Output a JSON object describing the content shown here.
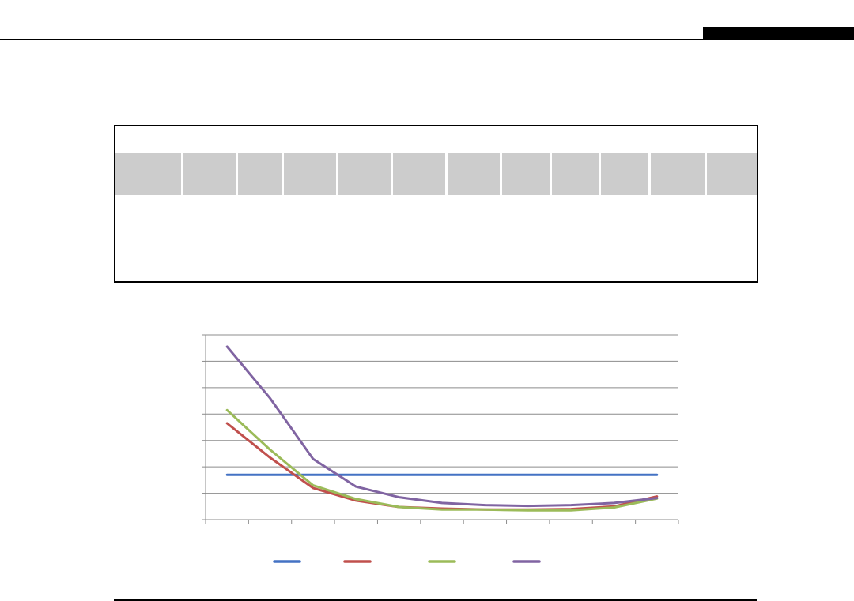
{
  "page": {
    "header_text": "",
    "table_title": ""
  },
  "table": {
    "header_cells": [
      "",
      "",
      "",
      "",
      "",
      "",
      "",
      "",
      "",
      "",
      "",
      ""
    ],
    "rows": []
  },
  "chart_data": {
    "type": "line",
    "title": "",
    "xlabel": "",
    "ylabel": "",
    "x": [
      1,
      2,
      3,
      4,
      5,
      6,
      7,
      8,
      9,
      10,
      11
    ],
    "ylim": [
      0,
      7
    ],
    "yticks": [
      0,
      1,
      2,
      3,
      4,
      5,
      6,
      7
    ],
    "grid": true,
    "legend_position": "bottom",
    "series": [
      {
        "color": "#4472C4",
        "values": [
          1.7,
          1.7,
          1.7,
          1.7,
          1.7,
          1.7,
          1.7,
          1.7,
          1.7,
          1.7,
          1.7
        ]
      },
      {
        "color": "#C0504D",
        "values": [
          3.65,
          2.35,
          1.2,
          0.72,
          0.48,
          0.42,
          0.38,
          0.38,
          0.4,
          0.5,
          0.88
        ]
      },
      {
        "color": "#9BBB59",
        "values": [
          4.15,
          2.65,
          1.3,
          0.78,
          0.48,
          0.38,
          0.38,
          0.35,
          0.35,
          0.46,
          0.8
        ]
      },
      {
        "color": "#8064A2",
        "values": [
          6.55,
          4.6,
          2.3,
          1.25,
          0.85,
          0.63,
          0.55,
          0.52,
          0.55,
          0.63,
          0.82
        ]
      }
    ]
  }
}
